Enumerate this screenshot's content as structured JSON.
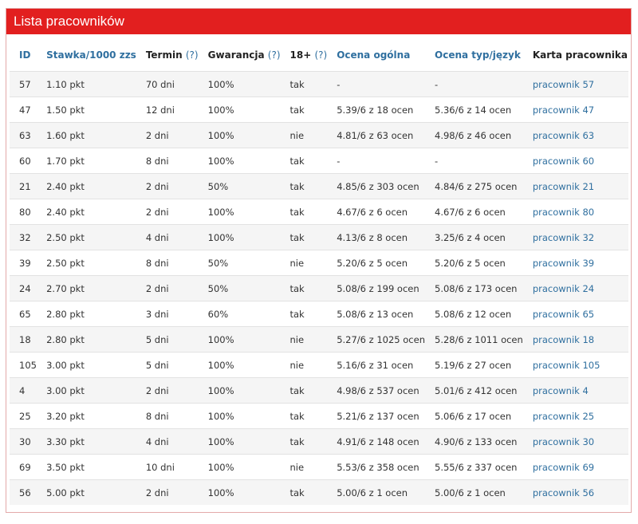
{
  "panel": {
    "title": "Lista pracowników"
  },
  "columns": [
    {
      "label": "ID",
      "help": ""
    },
    {
      "label": "Stawka/1000 zzs",
      "help": ""
    },
    {
      "label": "Termin",
      "help": "(?)"
    },
    {
      "label": "Gwarancja",
      "help": "(?)"
    },
    {
      "label": "18+",
      "help": "(?)"
    },
    {
      "label": "Ocena ogólna",
      "help": ""
    },
    {
      "label": "Ocena typ/język",
      "help": ""
    },
    {
      "label": "Karta pracownika",
      "help": ""
    }
  ],
  "rows": [
    [
      "57",
      "1.10 pkt",
      "70 dni",
      "100%",
      "tak",
      "-",
      "-",
      "pracownik 57"
    ],
    [
      "47",
      "1.50 pkt",
      "12 dni",
      "100%",
      "tak",
      "5.39/6 z 18 ocen",
      "5.36/6 z 14 ocen",
      "pracownik 47"
    ],
    [
      "63",
      "1.60 pkt",
      "2 dni",
      "100%",
      "nie",
      "4.81/6 z 63 ocen",
      "4.98/6 z 46 ocen",
      "pracownik 63"
    ],
    [
      "60",
      "1.70 pkt",
      "8 dni",
      "100%",
      "tak",
      "-",
      "-",
      "pracownik 60"
    ],
    [
      "21",
      "2.40 pkt",
      "2 dni",
      "50%",
      "tak",
      "4.85/6 z 303 ocen",
      "4.84/6 z 275 ocen",
      "pracownik 21"
    ],
    [
      "80",
      "2.40 pkt",
      "2 dni",
      "100%",
      "tak",
      "4.67/6 z 6 ocen",
      "4.67/6 z 6 ocen",
      "pracownik 80"
    ],
    [
      "32",
      "2.50 pkt",
      "4 dni",
      "100%",
      "tak",
      "4.13/6 z 8 ocen",
      "3.25/6 z 4 ocen",
      "pracownik 32"
    ],
    [
      "39",
      "2.50 pkt",
      "8 dni",
      "50%",
      "nie",
      "5.20/6 z 5 ocen",
      "5.20/6 z 5 ocen",
      "pracownik 39"
    ],
    [
      "24",
      "2.70 pkt",
      "2 dni",
      "50%",
      "tak",
      "5.08/6 z 199 ocen",
      "5.08/6 z 173 ocen",
      "pracownik 24"
    ],
    [
      "65",
      "2.80 pkt",
      "3 dni",
      "60%",
      "tak",
      "5.08/6 z 13 ocen",
      "5.08/6 z 12 ocen",
      "pracownik 65"
    ],
    [
      "18",
      "2.80 pkt",
      "5 dni",
      "100%",
      "nie",
      "5.27/6 z 1025 ocen",
      "5.28/6 z 1011 ocen",
      "pracownik 18"
    ],
    [
      "105",
      "3.00 pkt",
      "5 dni",
      "100%",
      "nie",
      "5.16/6 z 31 ocen",
      "5.19/6 z 27 ocen",
      "pracownik 105"
    ],
    [
      "4",
      "3.00 pkt",
      "2 dni",
      "100%",
      "tak",
      "4.98/6 z 537 ocen",
      "5.01/6 z 412 ocen",
      "pracownik 4"
    ],
    [
      "25",
      "3.20 pkt",
      "8 dni",
      "100%",
      "tak",
      "5.21/6 z 137 ocen",
      "5.06/6 z 17 ocen",
      "pracownik 25"
    ],
    [
      "30",
      "3.30 pkt",
      "4 dni",
      "100%",
      "tak",
      "4.91/6 z 148 ocen",
      "4.90/6 z 133 ocen",
      "pracownik 30"
    ],
    [
      "69",
      "3.50 pkt",
      "10 dni",
      "100%",
      "nie",
      "5.53/6 z 358 ocen",
      "5.55/6 z 337 ocen",
      "pracownik 69"
    ],
    [
      "56",
      "5.00 pkt",
      "2 dni",
      "100%",
      "tak",
      "5.00/6 z 1 ocen",
      "5.00/6 z 1 ocen",
      "pracownik 56"
    ]
  ],
  "colors": {
    "header_bg": "#e21f1f",
    "link": "#2f6f9f",
    "row_alt": "#f5f5f5"
  }
}
